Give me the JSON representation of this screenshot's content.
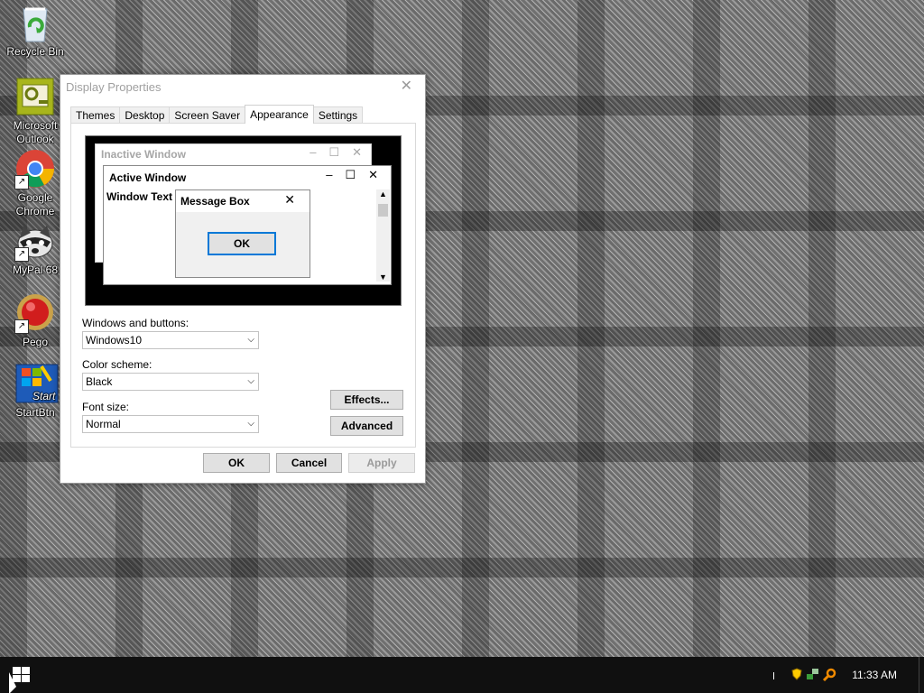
{
  "desktop": {
    "icons": [
      {
        "label": "Recycle Bin"
      },
      {
        "label": "Microsoft Outlook"
      },
      {
        "label": "Google Chrome"
      },
      {
        "label": "MyPal 68"
      },
      {
        "label": "Pego"
      },
      {
        "label": "StartBtn"
      }
    ]
  },
  "dialog": {
    "title": "Display Properties",
    "close": "✕",
    "tabs": [
      {
        "label": "Themes"
      },
      {
        "label": "Desktop"
      },
      {
        "label": "Screen Saver"
      },
      {
        "label": "Appearance",
        "active": true
      },
      {
        "label": "Settings"
      }
    ],
    "preview": {
      "inactive_title": "Inactive Window",
      "active_title": "Active Window",
      "window_text": "Window Text",
      "msgbox_title": "Message Box",
      "msgbox_ok": "OK",
      "minimize": "–",
      "maximize": "☐",
      "close": "✕"
    },
    "fields": {
      "windows_buttons_label": "Windows and buttons:",
      "windows_buttons_value": "Windows10",
      "color_scheme_label": "Color scheme:",
      "color_scheme_value": "Black",
      "font_size_label": "Font size:",
      "font_size_value": "Normal"
    },
    "buttons": {
      "effects": "Effects...",
      "advanced": "Advanced",
      "ok": "OK",
      "cancel": "Cancel",
      "apply": "Apply"
    }
  },
  "taskbar": {
    "clock": "11:33 AM"
  },
  "colors": {
    "focus_accent": "#0078d7",
    "taskbar_bg": "#101010"
  }
}
